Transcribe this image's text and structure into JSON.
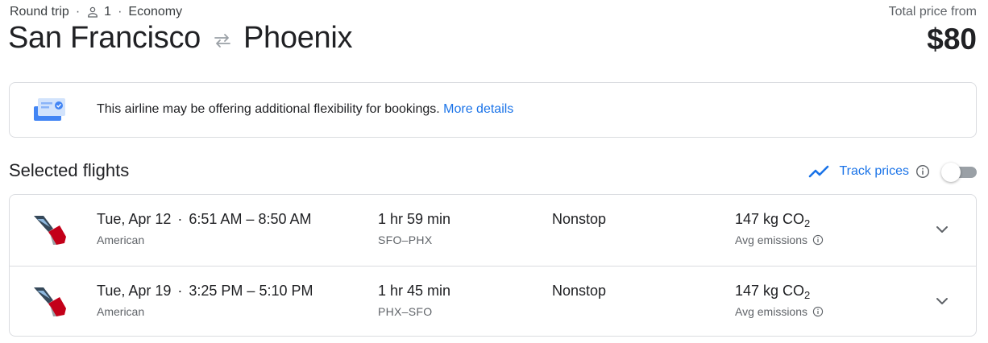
{
  "header": {
    "trip_type": "Round trip",
    "passengers": "1",
    "cabin": "Economy",
    "origin": "San Francisco",
    "destination": "Phoenix",
    "price_label": "Total price from",
    "price": "$80"
  },
  "notice": {
    "text": "This airline may be offering additional flexibility for bookings.",
    "link": "More details"
  },
  "section": {
    "title": "Selected flights",
    "track_label": "Track prices",
    "track_enabled": false
  },
  "flights": [
    {
      "date": "Tue, Apr 12",
      "times": "6:51 AM – 8:50 AM",
      "airline": "American",
      "duration": "1 hr 59 min",
      "airports": "SFO–PHX",
      "stops": "Nonstop",
      "emissions_value": "147 kg CO",
      "emissions_sub": "2",
      "emissions_label": "Avg emissions"
    },
    {
      "date": "Tue, Apr 19",
      "times": "3:25 PM – 5:10 PM",
      "airline": "American",
      "duration": "1 hr 45 min",
      "airports": "PHX–SFO",
      "stops": "Nonstop",
      "emissions_value": "147 kg CO",
      "emissions_sub": "2",
      "emissions_label": "Avg emissions"
    }
  ],
  "icons": {
    "person": "person-icon",
    "swap": "swap-arrows-icon",
    "ticket": "ticket-icon",
    "trend": "trending-up-icon",
    "info": "info-icon",
    "chevron": "chevron-down-icon",
    "airline_logo": "american-airlines-logo-icon"
  },
  "colors": {
    "accent": "#1a73e8",
    "text": "#202124",
    "muted": "#5f6368",
    "border": "#dadce0",
    "logo_blue": "#36495a",
    "logo_red": "#c30019",
    "logo_light": "#8fb8de"
  }
}
